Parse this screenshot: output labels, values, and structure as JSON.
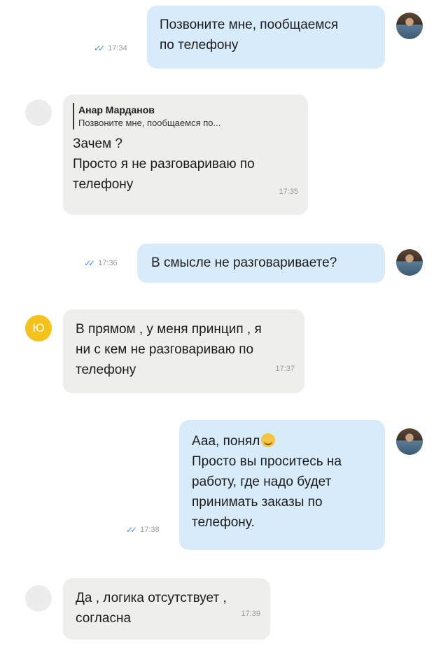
{
  "messages": [
    {
      "id": 1,
      "direction": "out",
      "lines": [
        "Позвоните мне, пообщаемся",
        "по телефону"
      ],
      "time": "17:34",
      "status": "read"
    },
    {
      "id": 2,
      "direction": "in",
      "reply": {
        "name": "Анар Марданов",
        "text": "Позвоните мне, пообщаемся по..."
      },
      "lines": [
        "Зачем ?",
        "Просто я не разговариваю по",
        "телефону"
      ],
      "time": "17:35"
    },
    {
      "id": 3,
      "direction": "out",
      "lines": [
        "В смысле не разговариваете?"
      ],
      "time": "17:36",
      "status": "read"
    },
    {
      "id": 4,
      "direction": "in",
      "avatar_letter": "Ю",
      "lines": [
        "В прямом , у меня принцип , я",
        "ни с кем не разговариваю по",
        "телефону"
      ],
      "time": "17:37"
    },
    {
      "id": 5,
      "direction": "out",
      "lines": [
        "Ааа, понял",
        "Просто вы проситесь на",
        "работу, где надо будет",
        "принимать заказы по",
        "телефону."
      ],
      "emoji": "grinning-sweat-emoji",
      "time": "17:38",
      "status": "read"
    },
    {
      "id": 6,
      "direction": "in",
      "lines": [
        "Да , логика отсутствует ,",
        "согласна"
      ],
      "time": "17:39"
    }
  ],
  "colors": {
    "outgoing_bubble": "#d8ebfb",
    "incoming_bubble": "#eeeeec",
    "read_ticks": "#4b8fd6",
    "avatar_yellow": "#f4c21a"
  },
  "icons": {
    "read_status": "double-check-icon",
    "user_avatar": "user-photo-avatar",
    "contact_avatar": "contact-avatar"
  }
}
